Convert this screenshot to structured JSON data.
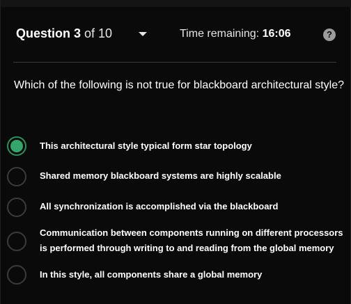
{
  "header": {
    "question_word": "Question 3",
    "question_total": " of 10",
    "time_label": "Time remaining: ",
    "time_value": "16:06",
    "help_glyph": "?",
    "dropdown_icon": "chevron-down-icon",
    "help_icon": "question-circle-icon"
  },
  "question": {
    "text": "Which of the following is not true for blackboard architectural style?"
  },
  "options": [
    {
      "label": "This architectural style typical form star topology",
      "selected": true
    },
    {
      "label": "Shared memory blackboard systems are highly scalable",
      "selected": false
    },
    {
      "label": "All synchronization is accomplished via the blackboard",
      "selected": false
    },
    {
      "label": "Communication between components running on different processors is performed through writing to and reading from the global memory",
      "selected": false
    },
    {
      "label": "In this style, all components share a global memory",
      "selected": false
    }
  ],
  "colors": {
    "background": "#0a0a0a",
    "accent_selected": "#35a56b",
    "radio_border": "#3b3b3b"
  }
}
